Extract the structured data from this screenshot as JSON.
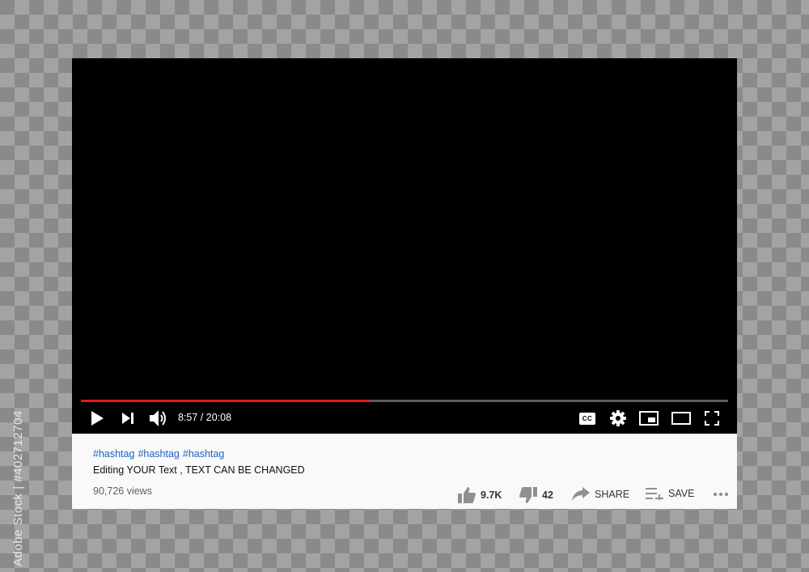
{
  "player": {
    "current_time": "8:57",
    "duration": "20:08",
    "time_display": "8:57 / 20:08",
    "progress_fraction": 0.445,
    "progress_color": "#e21b1b",
    "controls": [
      "play-icon",
      "next-icon",
      "volume-icon",
      "captions-icon",
      "gear-icon",
      "miniplayer-icon",
      "theater-icon",
      "fullscreen-icon"
    ],
    "captions_label": "CC"
  },
  "info": {
    "hashtags": [
      "#hashtag",
      "#hashtag",
      "#hashtag"
    ],
    "description": "Editing YOUR Text , TEXT CAN BE CHANGED",
    "views": "90,726 views",
    "likes": "9.7K",
    "dislikes": "42",
    "share_label": "SHARE",
    "save_label": "SAVE"
  },
  "watermark": {
    "text": "Adobe Stock | #402712704"
  }
}
